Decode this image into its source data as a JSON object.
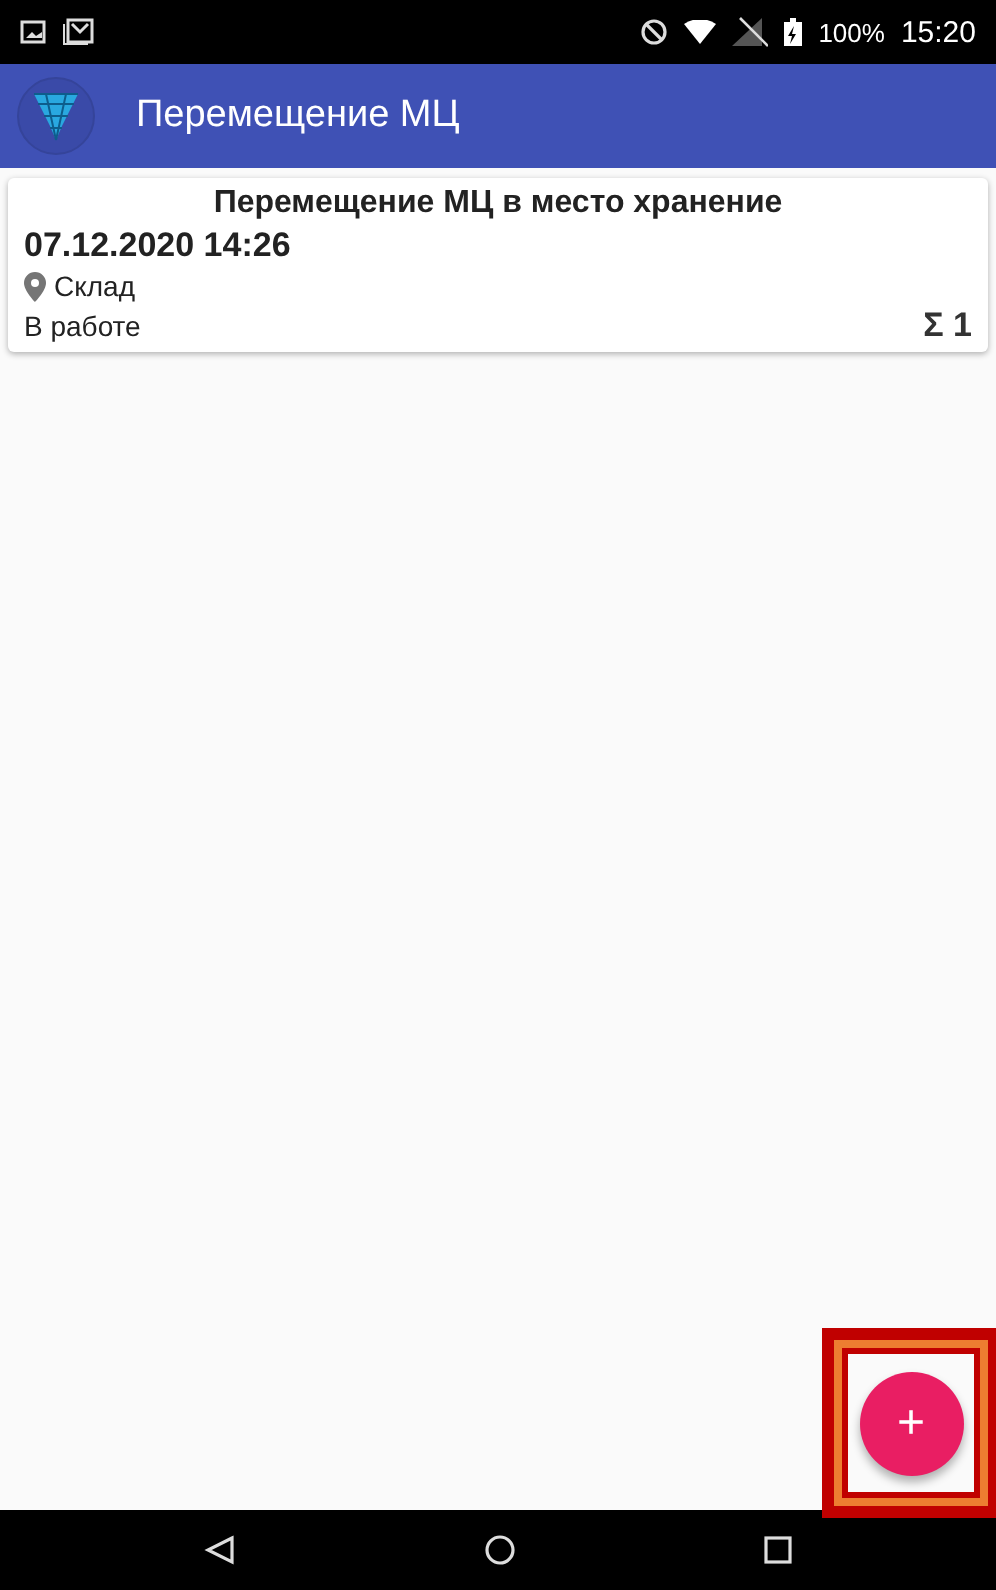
{
  "status_bar": {
    "battery": "100%",
    "time": "15:20"
  },
  "app_bar": {
    "title": "Перемещение МЦ"
  },
  "documents": [
    {
      "title": "Перемещение МЦ в место хранение",
      "date": "07.12.2020 14:26",
      "location": "Склад",
      "status": "В работе",
      "sum_sign": "Σ",
      "count": "1"
    }
  ],
  "fab": {
    "label": "+",
    "highlighted": true
  }
}
